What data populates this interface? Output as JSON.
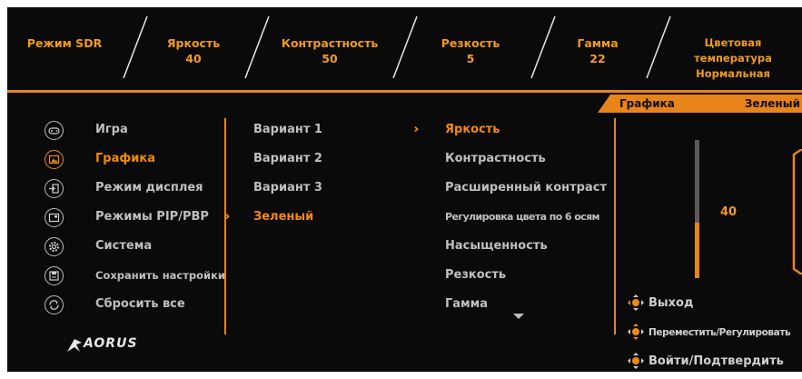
{
  "header": {
    "items": [
      {
        "label": "Режим SDR",
        "value": ""
      },
      {
        "label": "Яркость",
        "value": "40"
      },
      {
        "label": "Контрастность",
        "value": "50"
      },
      {
        "label": "Резкость",
        "value": "5"
      },
      {
        "label": "Гамма",
        "value": "22"
      },
      {
        "label": "Цветовая температура",
        "value": "Нормальная"
      }
    ]
  },
  "tabs": {
    "section": "Графика",
    "current": "Зеленый"
  },
  "main_menu": {
    "items": [
      {
        "label": "Игра",
        "icon": "gamepad-icon"
      },
      {
        "label": "Графика",
        "icon": "picture-icon",
        "selected": true
      },
      {
        "label": "Режим дисплея",
        "icon": "display-input-icon"
      },
      {
        "label": "Режимы PIP/PBP",
        "icon": "pip-icon"
      },
      {
        "label": "Система",
        "icon": "gear-icon"
      },
      {
        "label": "Сохранить настройки",
        "icon": "save-icon"
      },
      {
        "label": "Сбросить все",
        "icon": "reset-icon"
      }
    ]
  },
  "variant_menu": {
    "items": [
      {
        "label": "Вариант 1"
      },
      {
        "label": "Вариант 2"
      },
      {
        "label": "Вариант 3"
      },
      {
        "label": "Зеленый",
        "selected": true
      }
    ]
  },
  "settings_menu": {
    "items": [
      {
        "label": "Яркость",
        "selected": true
      },
      {
        "label": "Контрастность"
      },
      {
        "label": "Расширенный контраст"
      },
      {
        "label": "Регулировка цвета по 6 осям"
      },
      {
        "label": "Насыщенность"
      },
      {
        "label": "Резкость"
      },
      {
        "label": "Гамма"
      }
    ]
  },
  "slider": {
    "value": "40",
    "level_percent": 40
  },
  "hints": {
    "exit": "Выход",
    "move": "Переместить/Регулировать",
    "enter": "Войти/Подтвердить"
  },
  "logo": {
    "text": "AORUS"
  },
  "colors": {
    "accent": "#e8841a",
    "background": "#0a0a0a",
    "text": "#bfbfbf"
  }
}
